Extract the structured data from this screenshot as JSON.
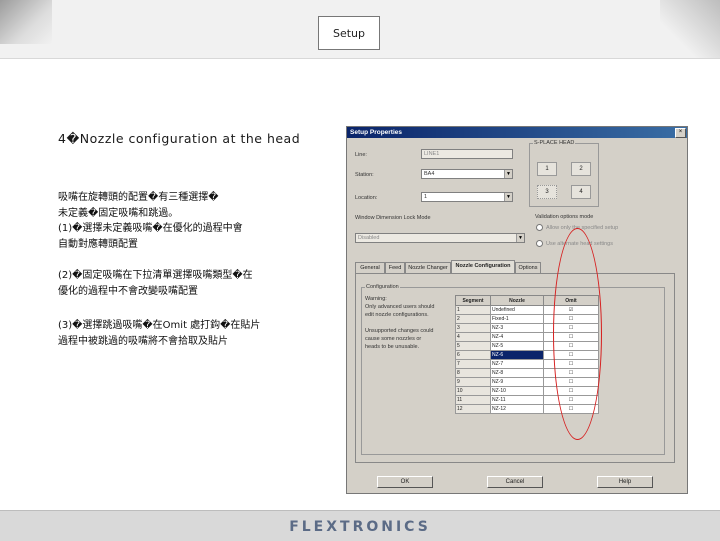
{
  "slide": {
    "title": "Setup",
    "heading": "4�Nozzle configuration at the head",
    "para1": [
      "吸嘴在旋轉頭的配置�有三種選擇�",
      "未定義�固定吸嘴和跳過。",
      "(1)�選擇未定義吸嘴�在優化的過程中會",
      "自動對應轉頭配置"
    ],
    "para2": [
      "(2)�固定吸嘴在下拉清單選擇吸嘴類型�在",
      "優化的過程中不會改變吸嘴配置"
    ],
    "para3": [
      "(3)�選擇跳過吸嘴�在Omit 處打鈎�在貼片",
      "過程中被跳過的吸嘴將不會拾取及貼片"
    ],
    "footer_logo": "FLEXTRONICS"
  },
  "dialog": {
    "title": "Setup Properties",
    "close": "×",
    "fields": [
      {
        "label": "Line:",
        "value": "LINE1"
      },
      {
        "label": "Station:",
        "value": "BA4"
      },
      {
        "label": "Location:",
        "value": "1"
      }
    ],
    "place_head_group": "S-PLACE HEAD",
    "head_buttons": [
      "1",
      "2",
      "3",
      "4"
    ],
    "window_label": "Window Dimension Lock Mode",
    "window_value": "Disabled",
    "validation_group": "Validation options mode",
    "radio_options": [
      "Allow only the specified setup",
      "Use alternate head settings"
    ],
    "tabs": [
      "General",
      "Feed",
      "Nozzle Changer",
      "Nozzle Configuration",
      "Options"
    ],
    "active_tab": 3,
    "config_group": "Configuration",
    "notes": [
      "Warning:",
      "Only advanced users should",
      "edit nozzle configurations.",
      "",
      "Unsupported changes could",
      "cause some nozzles or",
      "heads to be unusable."
    ],
    "table": {
      "headers": [
        "Segment",
        "Nozzle",
        "Omit"
      ],
      "rows": [
        {
          "seg": "1",
          "nozzle": "Undefined",
          "omit": "☑"
        },
        {
          "seg": "2",
          "nozzle": "Fixed-1",
          "omit": "☐"
        },
        {
          "seg": "3",
          "nozzle": "NZ-3",
          "omit": "☐"
        },
        {
          "seg": "4",
          "nozzle": "NZ-4",
          "omit": "☐"
        },
        {
          "seg": "5",
          "nozzle": "NZ-5",
          "omit": "☐"
        },
        {
          "seg": "6",
          "nozzle": "NZ-6",
          "omit": "☐"
        },
        {
          "seg": "7",
          "nozzle": "NZ-7",
          "omit": "☐"
        },
        {
          "seg": "8",
          "nozzle": "NZ-8",
          "omit": "☐"
        },
        {
          "seg": "9",
          "nozzle": "NZ-9",
          "omit": "☐"
        },
        {
          "seg": "10",
          "nozzle": "NZ-10",
          "omit": "☐"
        },
        {
          "seg": "11",
          "nozzle": "NZ-11",
          "omit": "☐"
        },
        {
          "seg": "12",
          "nozzle": "NZ-12",
          "omit": "☐"
        }
      ]
    },
    "buttons": [
      "OK",
      "Cancel",
      "Help"
    ]
  },
  "colors": {
    "highlight_ellipse": "#d62020",
    "titlebar": "#0a246a"
  }
}
